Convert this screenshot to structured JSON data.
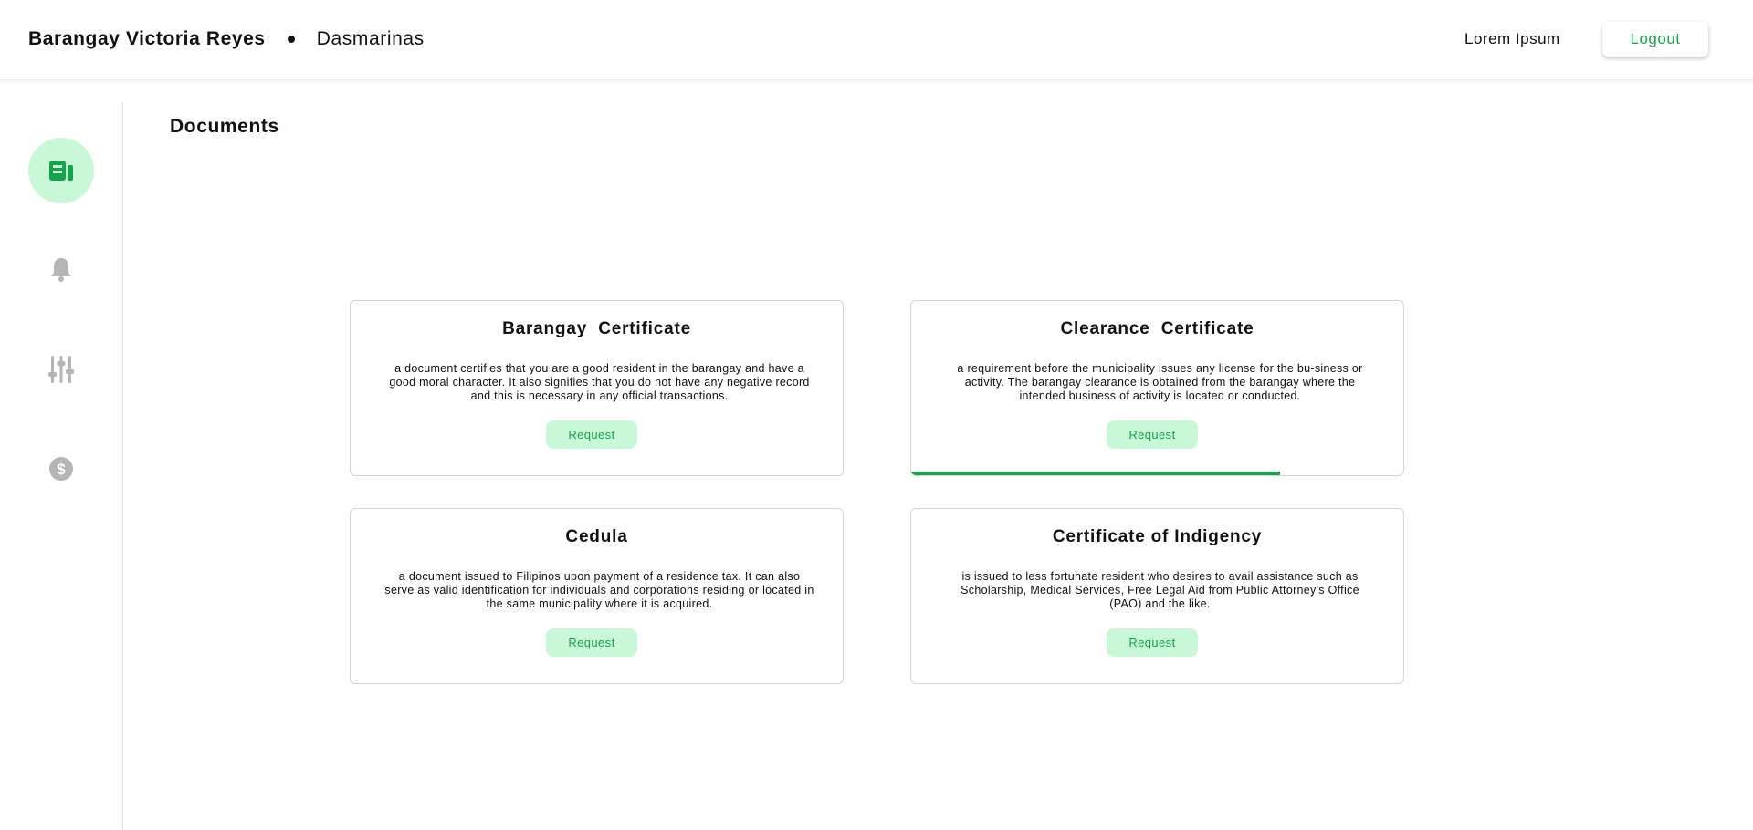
{
  "header": {
    "barangay": "Barangay Victoria Reyes",
    "city": "Dasmarinas",
    "user": "Lorem Ipsum",
    "logout_label": "Logout"
  },
  "sidebar": {
    "items": [
      {
        "icon": "document-icon",
        "active": true
      },
      {
        "icon": "bell-icon",
        "active": false
      },
      {
        "icon": "sliders-icon",
        "active": false
      },
      {
        "icon": "dollar-icon",
        "active": false
      }
    ]
  },
  "main": {
    "title": "Documents",
    "cards": [
      {
        "title": "Barangay  Certificate",
        "description": "a document certifies that you are a good resident in the barangay and have a good moral character. It also signifies that you do not have any negative record and this is necessary in any official transactions.",
        "button": "Request"
      },
      {
        "title": "Clearance  Certificate",
        "description": "a requirement before the municipality issues any license for the bu-siness or activity. The barangay clearance is obtained from the barangay where the intended business of activity is located or conducted.",
        "button": "Request",
        "progress": 0.75
      },
      {
        "title": "Cedula",
        "description": "a document issued to Filipinos upon payment of a residence tax. It can also serve as valid identification for individuals and corporations residing or located in the same municipality where it is acquired.",
        "button": "Request"
      },
      {
        "title": "Certificate of Indigency",
        "description": "is issued to less fortunate resident who desires to avail assistance such as Scholarship, Medical Services, Free Legal Aid from Public Attorney's Office (PAO) and the like.",
        "button": "Request"
      }
    ]
  },
  "colors": {
    "accent": "#16a34a",
    "accent_light": "#c9f8d8",
    "icon_inactive": "#b5b5b5"
  }
}
